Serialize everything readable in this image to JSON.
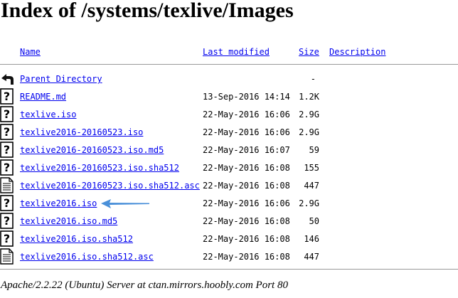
{
  "page": {
    "title": "Index of /systems/texlive/Images"
  },
  "columns": {
    "name": "Name",
    "last_modified": "Last modified",
    "size": "Size",
    "description": "Description"
  },
  "parent": {
    "label": "Parent Directory",
    "size": "-"
  },
  "rows": [
    {
      "name": "README.md",
      "modified": "13-Sep-2016 14:14",
      "size": "1.2K",
      "icon": "unknown-file-icon"
    },
    {
      "name": "texlive.iso",
      "modified": "22-May-2016 16:06",
      "size": "2.9G",
      "icon": "unknown-file-icon"
    },
    {
      "name": "texlive2016-20160523.iso",
      "modified": "22-May-2016 16:06",
      "size": "2.9G",
      "icon": "unknown-file-icon"
    },
    {
      "name": "texlive2016-20160523.iso.md5",
      "modified": "22-May-2016 16:07",
      "size": "59",
      "icon": "unknown-file-icon"
    },
    {
      "name": "texlive2016-20160523.iso.sha512",
      "modified": "22-May-2016 16:08",
      "size": "155",
      "icon": "unknown-file-icon"
    },
    {
      "name": "texlive2016-20160523.iso.sha512.asc",
      "modified": "22-May-2016 16:08",
      "size": "447",
      "icon": "text-file-icon"
    },
    {
      "name": "texlive2016.iso",
      "modified": "22-May-2016 16:06",
      "size": "2.9G",
      "icon": "unknown-file-icon"
    },
    {
      "name": "texlive2016.iso.md5",
      "modified": "22-May-2016 16:08",
      "size": "50",
      "icon": "unknown-file-icon"
    },
    {
      "name": "texlive2016.iso.sha512",
      "modified": "22-May-2016 16:08",
      "size": "146",
      "icon": "unknown-file-icon"
    },
    {
      "name": "texlive2016.iso.sha512.asc",
      "modified": "22-May-2016 16:08",
      "size": "447",
      "icon": "text-file-icon"
    }
  ],
  "annotation": {
    "icon": "arrow-left-icon",
    "color": "#4a90d9"
  },
  "footer": {
    "text": "Apache/2.2.22 (Ubuntu) Server at ctan.mirrors.hoobly.com Port 80"
  },
  "colors": {
    "link": "#0000ee",
    "rule": "#999999"
  }
}
